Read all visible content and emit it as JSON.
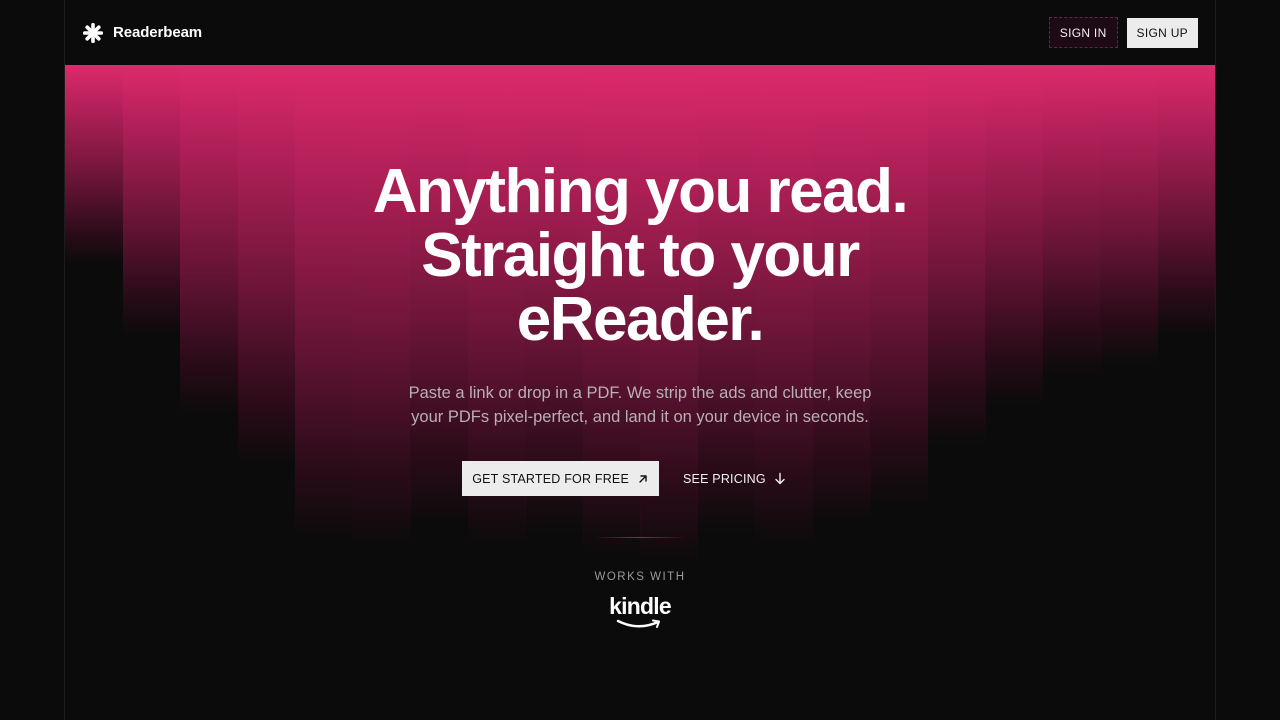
{
  "header": {
    "brand_name": "Readerbeam",
    "brand_icon": "asterisk-logo-icon",
    "sign_in_label": "SIGN IN",
    "sign_up_label": "SIGN UP"
  },
  "hero": {
    "headline_lines": [
      "Anything you read.",
      "Straight to your",
      "eReader."
    ],
    "subtext_lines": [
      "Paste a link or drop in a PDF. We strip the ads and clutter, keep",
      "your PDFs pixel-perfect, and land it on your device in seconds."
    ],
    "primary_cta_label": "GET STARTED FOR FREE",
    "primary_cta_icon": "arrow-up-right-icon",
    "secondary_cta_label": "SEE PRICING",
    "secondary_cta_icon": "arrow-down-icon",
    "works_with_label": "WORKS WITH",
    "partner_logo_text": "kindle"
  },
  "colors": {
    "accent": "#de2a6c",
    "background": "#0b0b0b",
    "button_light": "#ececec"
  }
}
